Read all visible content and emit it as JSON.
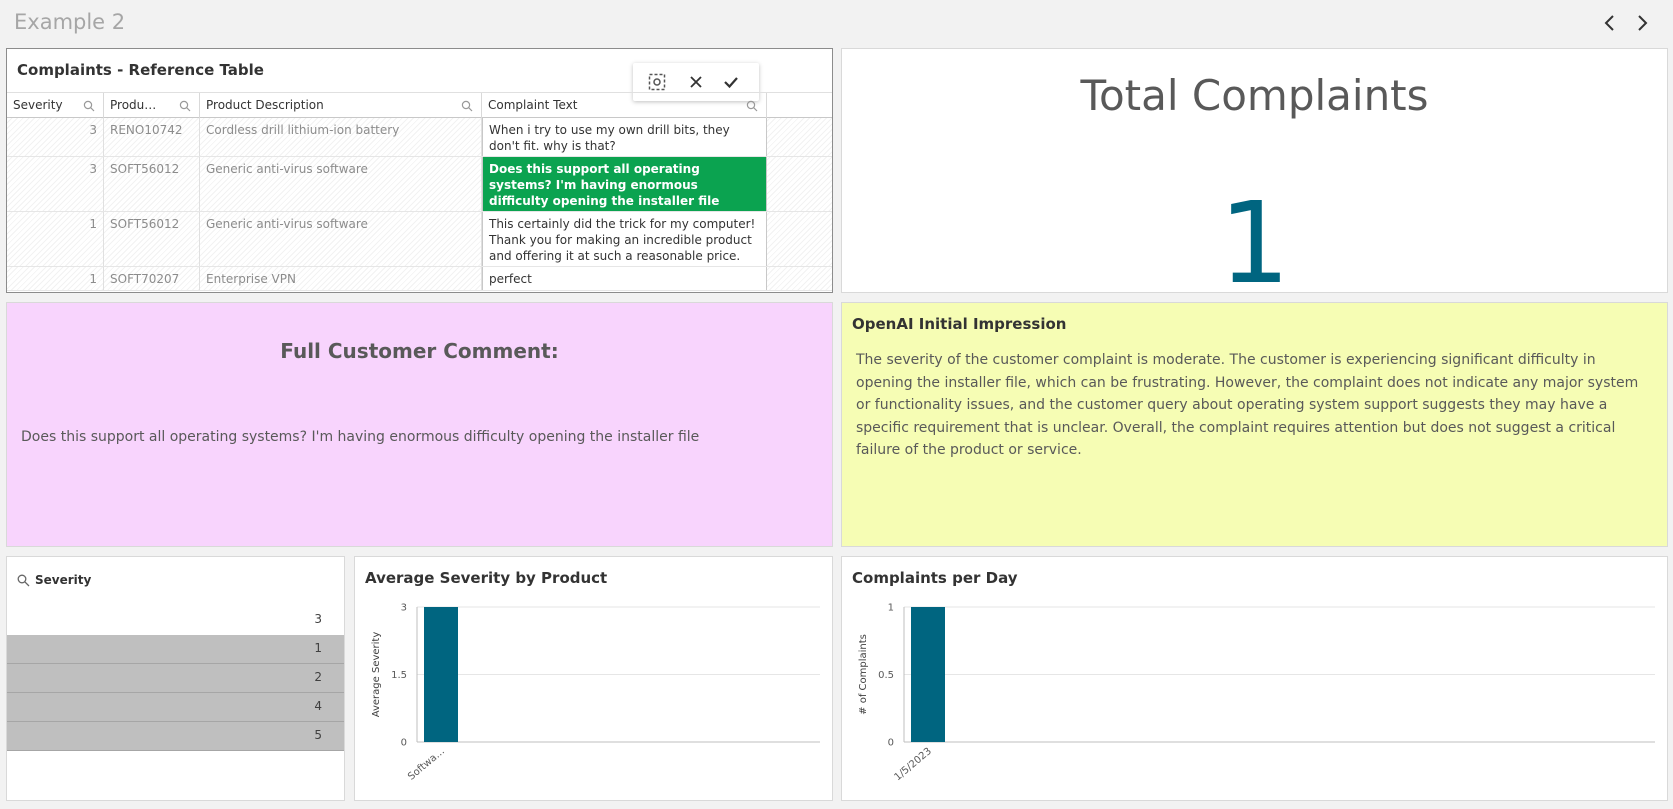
{
  "sheet": {
    "title": "Example 2"
  },
  "reference_table": {
    "title": "Complaints - Reference Table",
    "columns": [
      "Severity",
      "Produ…",
      "Product Description",
      "Complaint Text"
    ],
    "rows": [
      {
        "severity": "3",
        "product": "RENO10742",
        "description": "Cordless drill lithium-ion battery",
        "complaint": "When i try to use my own drill bits, they don't fit. why is that?"
      },
      {
        "severity": "3",
        "product": "SOFT56012",
        "description": "Generic anti-virus software",
        "complaint": "Does this support all operating systems? I'm having enormous difficulty opening the installer file",
        "selected": true
      },
      {
        "severity": "1",
        "product": "SOFT56012",
        "description": "Generic anti-virus software",
        "complaint": "This certainly did the trick for my computer! Thank you for making an incredible product and offering it at such a reasonable price."
      },
      {
        "severity": "1",
        "product": "SOFT70207",
        "description": "Enterprise VPN",
        "complaint": "perfect"
      }
    ]
  },
  "kpi": {
    "label": "Total Complaints",
    "value": "1",
    "color": "#006580"
  },
  "comment": {
    "heading": "Full Customer Comment:",
    "text": "Does this support all operating systems? I'm having enormous difficulty opening the installer file"
  },
  "openai": {
    "title": "OpenAI Initial Impression",
    "text": "The severity of the customer complaint is moderate. The customer is experiencing significant difficulty in opening the installer file, which can be frustrating. However, the complaint does not indicate any major system or functionality issues, and the customer query about operating system support suggests they may have a specific requirement that is unclear. Overall, the complaint requires attention but does not suggest a critical failure of the product or service."
  },
  "filter": {
    "title": "Severity",
    "items": [
      {
        "value": "3",
        "state": "possible"
      },
      {
        "value": "1",
        "state": "alternative"
      },
      {
        "value": "2",
        "state": "alternative"
      },
      {
        "value": "4",
        "state": "alternative"
      },
      {
        "value": "5",
        "state": "alternative"
      }
    ]
  },
  "chart_data": [
    {
      "type": "bar",
      "title": "Average Severity by Product",
      "categories": [
        "Softwa…"
      ],
      "values": [
        3
      ],
      "xlabel": "",
      "ylabel": "Average Severity",
      "ylim": [
        0,
        3
      ],
      "yticks": [
        "0",
        "1.5",
        "3"
      ],
      "grid": true,
      "color": "#006580"
    },
    {
      "type": "bar",
      "title": "Complaints per Day",
      "categories": [
        "1/5/2023"
      ],
      "values": [
        1
      ],
      "xlabel": "",
      "ylabel": "# of Complaints",
      "ylim": [
        0,
        1
      ],
      "yticks": [
        "0",
        "0.5",
        "1"
      ],
      "grid": true,
      "color": "#006580"
    }
  ],
  "colors": {
    "selected": "#0ba350",
    "comment_bg": "#f8d4fd",
    "openai_bg": "#f6fdb4",
    "alternative": "#bfbfbf"
  },
  "icons": [
    "chevron-left-icon",
    "chevron-right-icon",
    "selection-tool-icon",
    "close-icon",
    "check-icon",
    "search-icon"
  ]
}
